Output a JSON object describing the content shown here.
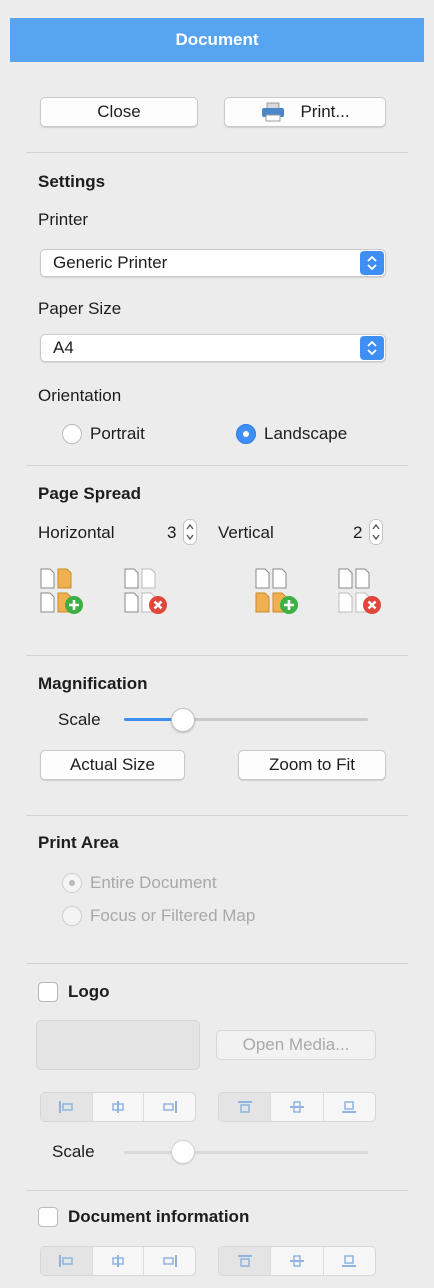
{
  "title": "Document",
  "buttons": {
    "close": "Close",
    "print": "Print...",
    "actual_size": "Actual Size",
    "zoom_to_fit": "Zoom to Fit",
    "open_media": "Open Media..."
  },
  "settings": {
    "heading": "Settings",
    "printer_label": "Printer",
    "printer_value": "Generic Printer",
    "paper_label": "Paper Size",
    "paper_value": "A4",
    "orientation_label": "Orientation",
    "orientation_options": [
      "Portrait",
      "Landscape"
    ],
    "orientation_selected": "Landscape"
  },
  "page_spread": {
    "heading": "Page Spread",
    "horizontal_label": "Horizontal",
    "horizontal_value": "3",
    "vertical_label": "Vertical",
    "vertical_value": "2"
  },
  "magnification": {
    "heading": "Magnification",
    "scale_label": "Scale",
    "scale_fraction": 0.24
  },
  "print_area": {
    "heading": "Print Area",
    "options": [
      "Entire Document",
      "Focus or Filtered Map"
    ],
    "selected": "Entire Document"
  },
  "logo": {
    "label": "Logo",
    "checked": false,
    "scale_label": "Scale",
    "scale_fraction": 0.24
  },
  "document_information": {
    "label": "Document information",
    "checked": false
  },
  "colors": {
    "accent": "#3e8ef3",
    "titlebar": "#57a4f0",
    "add": "#3cb043",
    "remove": "#e0463a",
    "page_fill": "#f0b050"
  }
}
